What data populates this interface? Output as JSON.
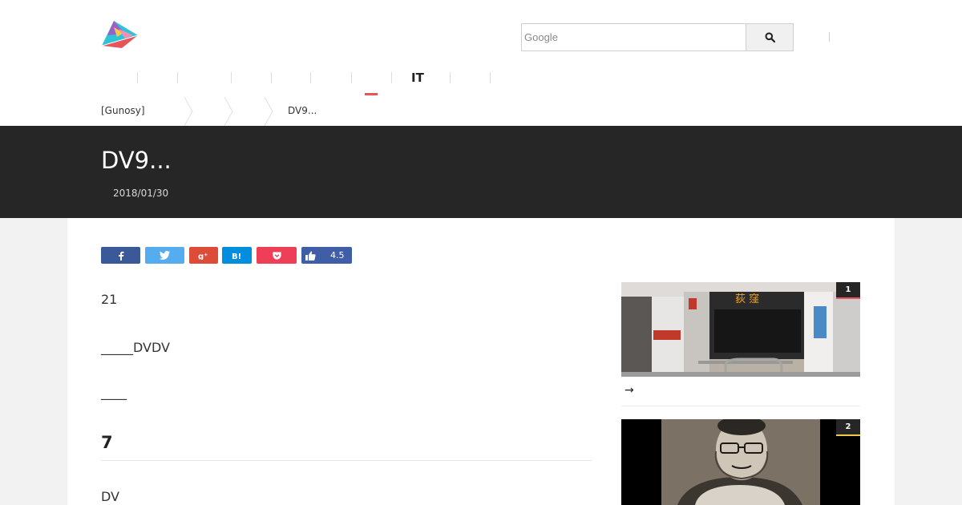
{
  "header": {
    "logo_icon": "paper-plane-logo-icon",
    "search": {
      "placeholder": "Google",
      "button_icon": "search-icon"
    }
  },
  "nav": {
    "items": [
      {
        "label": ""
      },
      {
        "label": ""
      },
      {
        "label": ""
      },
      {
        "label": ""
      },
      {
        "label": ""
      },
      {
        "label": ""
      },
      {
        "label": ""
      },
      {
        "label": "IT"
      },
      {
        "label": ""
      },
      {
        "label": ""
      }
    ],
    "active_index": 6,
    "active_color": "#e8545c"
  },
  "breadcrumb": {
    "items": [
      "[Gunosy]",
      "",
      "",
      "DV9..."
    ]
  },
  "article": {
    "title": "DV9...",
    "date": "2018/01/30",
    "paragraphs": [
      "21",
      "_____DVDV",
      "____"
    ],
    "heading": "7",
    "after_heading": "DV"
  },
  "share": {
    "buttons": [
      {
        "name": "facebook",
        "icon": "facebook-icon",
        "color": "#3b5998"
      },
      {
        "name": "twitter",
        "icon": "twitter-icon",
        "color": "#55acee"
      },
      {
        "name": "googleplus",
        "icon": "google-plus-icon",
        "color": "#dd4b39"
      },
      {
        "name": "hatena",
        "icon": "hatena-bookmark-icon",
        "color": "#008fde"
      },
      {
        "name": "pocket",
        "icon": "pocket-icon",
        "color": "#ef3f56"
      },
      {
        "name": "like",
        "icon": "thumbs-up-icon",
        "color": "#3f5ea7",
        "count": "4.5"
      }
    ]
  },
  "sidebar": {
    "cards": [
      {
        "rank": "1",
        "caption": "→",
        "image": "subway-train-platform-photo",
        "accent": "#e8545c"
      },
      {
        "rank": "2",
        "caption": "",
        "image": "man-portrait-illustration",
        "accent": "#f2c94c"
      }
    ]
  }
}
